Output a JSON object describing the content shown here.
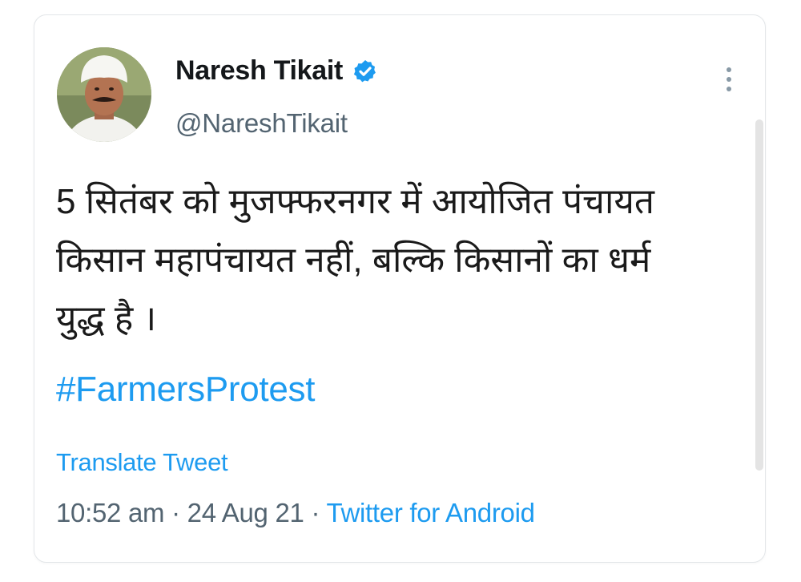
{
  "author": {
    "display_name": "Naresh Tikait",
    "handle": "@NareshTikait",
    "verified": true
  },
  "tweet": {
    "text_lines": [
      "5 सितंबर को मुजफ्फरनगर में आयोजित पंचायत",
      "किसान महापंचायत नहीं, बल्कि किसानों का धर्म",
      "युद्ध है ।"
    ],
    "hashtag": "#FarmersProtest",
    "translate_label": "Translate Tweet",
    "time": "10:52 am",
    "date": "24 Aug 21",
    "separator": " · ",
    "source": "Twitter for Android"
  },
  "icons": {
    "verified": "verified-badge-icon",
    "more": "more-options-icon"
  },
  "colors": {
    "accent": "#1d9bf0",
    "text": "#14171a",
    "muted": "#536471"
  }
}
